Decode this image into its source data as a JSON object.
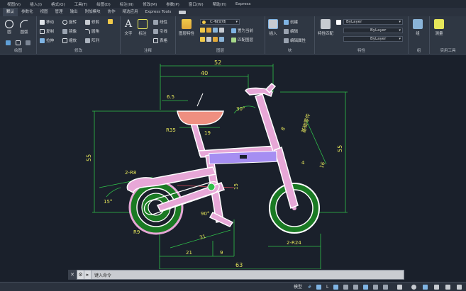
{
  "menubar": {
    "items": [
      "视图(V)",
      "插入(I)",
      "格式(O)",
      "工具(T)",
      "绘图(D)",
      "标注(N)",
      "修改(M)",
      "参数(P)",
      "窗口(W)",
      "帮助(H)",
      "Express"
    ]
  },
  "ribbon_tabs": {
    "items": [
      "默认",
      "参数化",
      "视图",
      "管理",
      "输出",
      "附加模块",
      "协作",
      "精选应用",
      "Express Tools"
    ],
    "active_index": 0
  },
  "ribbon": {
    "draw": {
      "label": "绘图",
      "circle": "圆",
      "arc": "圆弧"
    },
    "modify": {
      "label": "修改",
      "move": "移动",
      "rotate": "旋转",
      "trim": "修剪",
      "copy": "复制",
      "mirror": "镜像",
      "fillet": "圆角",
      "stretch": "拉伸",
      "scale": "缩放",
      "array": "阵列"
    },
    "annotation": {
      "label": "注释",
      "text": "文字",
      "dimension": "标注",
      "linear": "线性",
      "leader": "引线",
      "table": "表格"
    },
    "layers": {
      "label": "图层",
      "properties": "图层特性",
      "current": "C-相交线",
      "make_current": "置为当前",
      "match": "匹配图层"
    },
    "block": {
      "label": "块",
      "insert": "插入",
      "create": "创建",
      "edit": "编辑",
      "edit_attr": "编辑属性"
    },
    "properties": {
      "label": "特性",
      "match": "特性匹配",
      "color": "ByLayer",
      "linetype": "ByLayer",
      "lineweight": "ByLayer"
    },
    "groups": {
      "label": "组",
      "group": "组"
    },
    "utilities": {
      "label": "实用工具",
      "measure": "测量"
    }
  },
  "drawing": {
    "dimensions": {
      "overall_top": "52",
      "top_inner": "40",
      "seat_width": "19",
      "saddle_offset": "6.5",
      "seat_radius": "R35",
      "handle_angle": "30°",
      "front_length": "55",
      "fork": "16",
      "left_height": "15",
      "chain_radius": "2-R8",
      "rear_angle": "15°",
      "wheel_radius": "R9",
      "front_wheel": "2-R24",
      "bottom_overall": "63",
      "bottom_left": "21",
      "bottom_mid": "9",
      "small_a": "8",
      "small_b": "4",
      "chainstay": "31",
      "angle_90": "90°",
      "height_55b": "55",
      "rod_label": "基础零件"
    },
    "colors": {
      "background": "#1a202b",
      "frame": "#e7a7d7",
      "wheel": "#1a7a23",
      "seat": "#ef8f80",
      "battery": "#a68ef2",
      "dimension": "#e6e65a",
      "highlight": "#d84a5a"
    }
  },
  "command_line": {
    "placeholder": "键入命令"
  },
  "statusbar": {
    "model_tab": "模型",
    "grid_toggle": "#",
    "ortho": "L"
  }
}
